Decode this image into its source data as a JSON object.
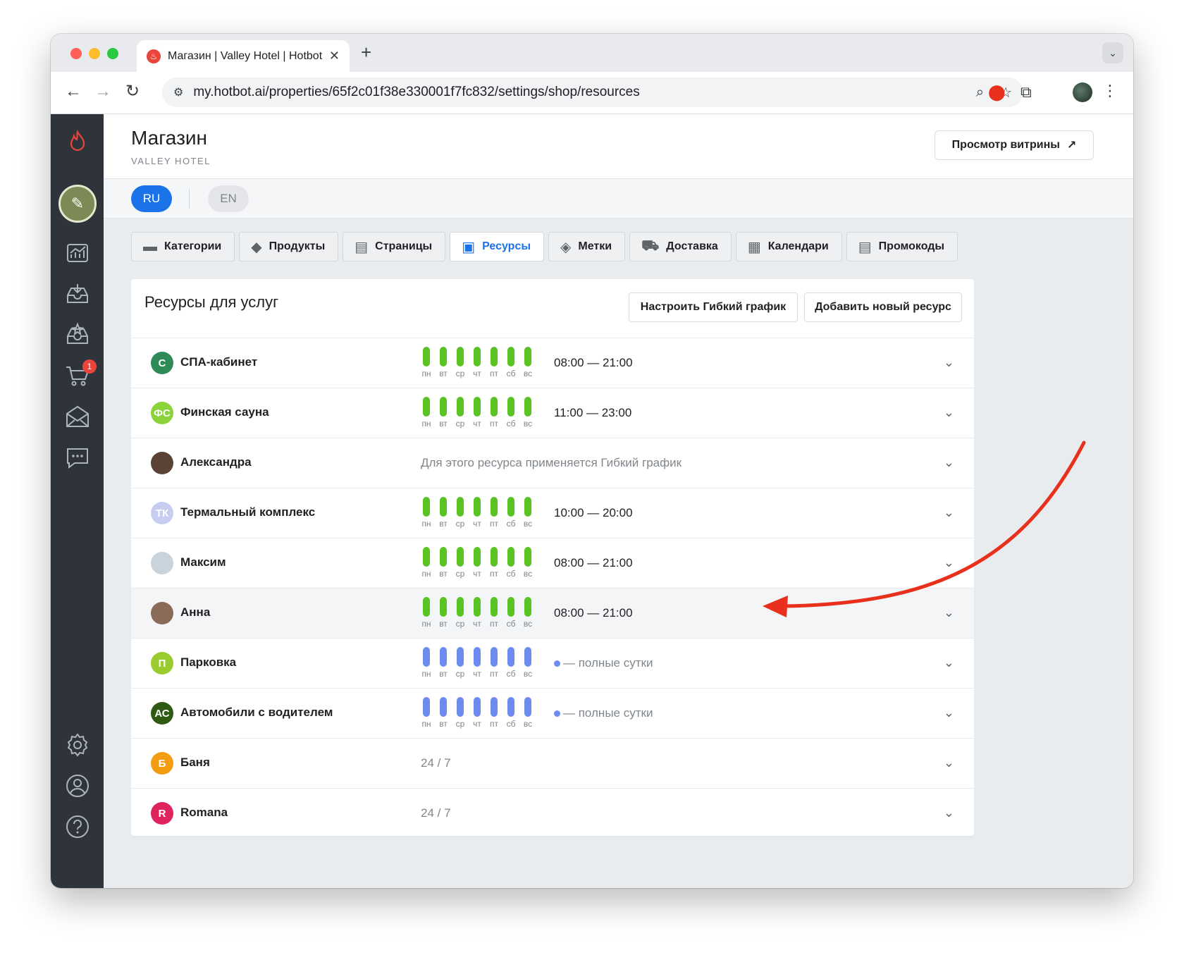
{
  "browser": {
    "tab_title": "Магазин | Valley Hotel | Hotbot",
    "tab_close": "✕",
    "new_tab": "+",
    "url": "my.hotbot.ai/properties/65f2c01f38e330001f7fc832/settings/shop/resources"
  },
  "sidebar": {
    "cart_badge": "1",
    "icons": [
      "flame-logo-icon",
      "chart-icon",
      "inbox-download-icon",
      "inbox-star-icon",
      "cart-icon",
      "mail-icon",
      "chat-icon",
      "settings-icon",
      "account-icon",
      "help-icon"
    ]
  },
  "header": {
    "title": "Магазин",
    "subtitle": "VALLEY HOTEL",
    "storefront_button": "Просмотр витрины",
    "storefront_arrow": "↗"
  },
  "languages": {
    "active": "RU",
    "inactive": "EN"
  },
  "tabs": [
    {
      "label": "Категории",
      "icon": "▬"
    },
    {
      "label": "Продукты",
      "icon": "◆"
    },
    {
      "label": "Страницы",
      "icon": "▤"
    },
    {
      "label": "Ресурсы",
      "icon": "▣"
    },
    {
      "label": "Метки",
      "icon": "◈"
    },
    {
      "label": "Доставка",
      "icon": "⛟"
    },
    {
      "label": "Календари",
      "icon": "▦"
    },
    {
      "label": "Промокоды",
      "icon": "▤"
    }
  ],
  "card": {
    "title": "Ресурсы для услуг",
    "flex_button": "Настроить Гибкий график",
    "add_button": "Добавить новый ресурс"
  },
  "day_labels": [
    "пн",
    "вт",
    "ср",
    "чт",
    "пт",
    "сб",
    "вс"
  ],
  "resources": [
    {
      "name": "СПА-кабинет",
      "initials": "С",
      "color": "#2e8b57",
      "hours": "08:00 — 21:00"
    },
    {
      "name": "Финская сауна",
      "initials": "ФС",
      "color": "#8bd33b",
      "hours": "11:00 — 23:00"
    },
    {
      "name": "Александра",
      "initials": "",
      "color": "#5a4236",
      "note": "Для этого ресурса применяется Гибкий график"
    },
    {
      "name": "Термальный комплекс",
      "initials": "ТК",
      "color": "#c7cdf0",
      "hours": "10:00 — 20:00"
    },
    {
      "name": "Максим",
      "initials": "",
      "color": "#c9d3db",
      "hours": "08:00 — 21:00"
    },
    {
      "name": "Анна",
      "initials": "",
      "color": "#8a6a58",
      "hours": "08:00 — 21:00"
    },
    {
      "name": "Парковка",
      "initials": "П",
      "color": "#9acb2f",
      "full_day": "— полные сутки"
    },
    {
      "name": "Автомобили с водителем",
      "initials": "АС",
      "color": "#2f5a14",
      "full_day": "— полные сутки"
    },
    {
      "name": "Баня",
      "initials": "Б",
      "color": "#f39c12",
      "note": "24 / 7"
    },
    {
      "name": "Romana",
      "initials": "R",
      "color": "#e0245e",
      "note": "24 / 7"
    }
  ],
  "colors": {
    "accent": "#1a73e8",
    "schedule_green": "#58c322",
    "schedule_blue": "#6e8bf0",
    "annotation_arrow": "#e8301c"
  }
}
